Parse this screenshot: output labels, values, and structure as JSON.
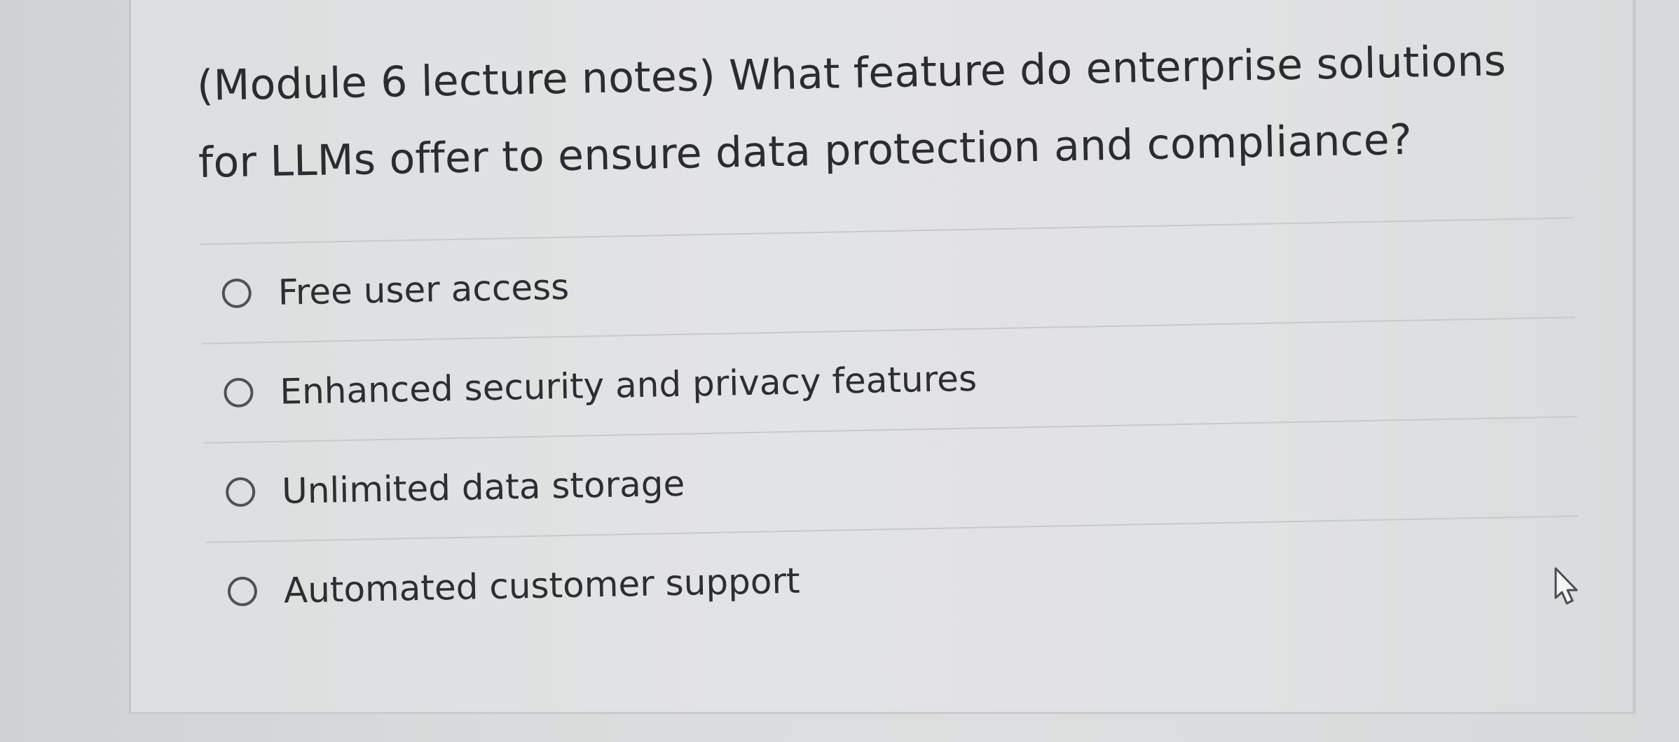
{
  "question": {
    "text": "(Module 6 lecture notes) What feature do enterprise solutions for LLMs offer to ensure data protection and compliance?"
  },
  "options": [
    {
      "label": "Free user access"
    },
    {
      "label": "Enhanced security and privacy features"
    },
    {
      "label": "Unlimited data storage"
    },
    {
      "label": "Automated customer support"
    }
  ],
  "cursor_icon": "mouse-pointer-hand-icon"
}
